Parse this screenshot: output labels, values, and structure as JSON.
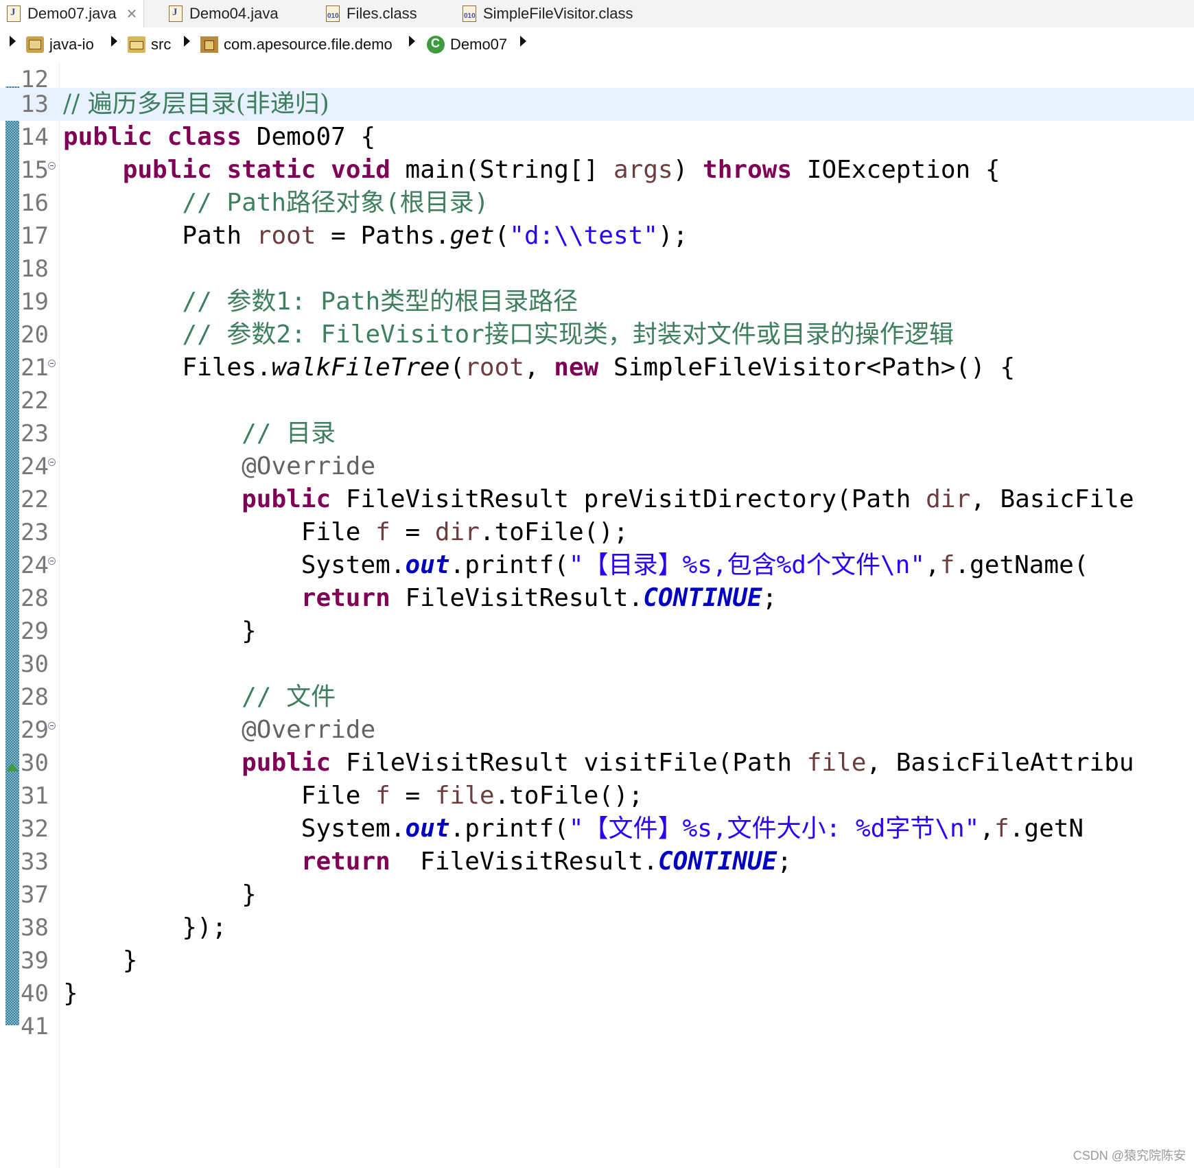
{
  "tabs": [
    {
      "label": "Demo07.java",
      "icon": "java-file-icon",
      "active": true
    },
    {
      "label": "Demo04.java",
      "icon": "java-file-icon",
      "active": false
    },
    {
      "label": "Files.class",
      "icon": "class-file-icon",
      "active": false
    },
    {
      "label": "SimpleFileVisitor.class",
      "icon": "class-file-icon",
      "active": false
    }
  ],
  "breadcrumb": {
    "project": "java-io",
    "src": "src",
    "package": "com.apesource.file.demo",
    "class": "Demo07"
  },
  "lines": [
    {
      "n": "12",
      "text": ""
    },
    {
      "n": "13",
      "text": "// 遍历多层目录(非递归)"
    },
    {
      "n": "14",
      "text": "public class Demo07 {"
    },
    {
      "n": "15",
      "text": "    public static void main(String[] args) throws IOException {"
    },
    {
      "n": "16",
      "text": "        // Path路径对象(根目录)"
    },
    {
      "n": "17",
      "text": "        Path root = Paths.get(\"d:\\\\test\");"
    },
    {
      "n": "18",
      "text": ""
    },
    {
      "n": "19",
      "text": "        // 参数1: Path类型的根目录路径"
    },
    {
      "n": "20",
      "text": "        // 参数2: FileVisitor接口实现类，封装对文件或目录的操作逻辑"
    },
    {
      "n": "21",
      "text": "        Files.walkFileTree(root, new SimpleFileVisitor<Path>() {"
    },
    {
      "n": "22",
      "text": ""
    },
    {
      "n": "23",
      "text": "            // 目录"
    },
    {
      "n": "24",
      "text": "            @Override"
    },
    {
      "n": "22",
      "text": "            public FileVisitResult preVisitDirectory(Path dir, BasicFile"
    },
    {
      "n": "23",
      "text": "                File f = dir.toFile();"
    },
    {
      "n": "24",
      "text": "                System.out.printf(\"【目录】%s,包含%d个文件\\n\",f.getName("
    },
    {
      "n": "28",
      "text": "                return FileVisitResult.CONTINUE;"
    },
    {
      "n": "29",
      "text": "            }"
    },
    {
      "n": "30",
      "text": ""
    },
    {
      "n": "28",
      "text": "            // 文件"
    },
    {
      "n": "29",
      "text": "            @Override"
    },
    {
      "n": "30",
      "text": "            public FileVisitResult visitFile(Path file, BasicFileAttribu"
    },
    {
      "n": "31",
      "text": "                File f = file.toFile();"
    },
    {
      "n": "32",
      "text": "                System.out.printf(\"【文件】%s,文件大小: %d字节\\n\",f.getN"
    },
    {
      "n": "33",
      "text": "                return  FileVisitResult.CONTINUE;"
    },
    {
      "n": "37",
      "text": "            }"
    },
    {
      "n": "38",
      "text": "        });"
    },
    {
      "n": "39",
      "text": "    }"
    },
    {
      "n": "40",
      "text": "}"
    },
    {
      "n": "41",
      "text": ""
    }
  ],
  "watermark": "CSDN @猿究院陈安",
  "colors": {
    "keyword": "#7f0055",
    "comment": "#3f7f5f",
    "string": "#2a00ff",
    "static_field": "#0000c0",
    "local_variable": "#6a3e3e",
    "annotation": "#646464",
    "current_line": "#e8f2fe"
  }
}
